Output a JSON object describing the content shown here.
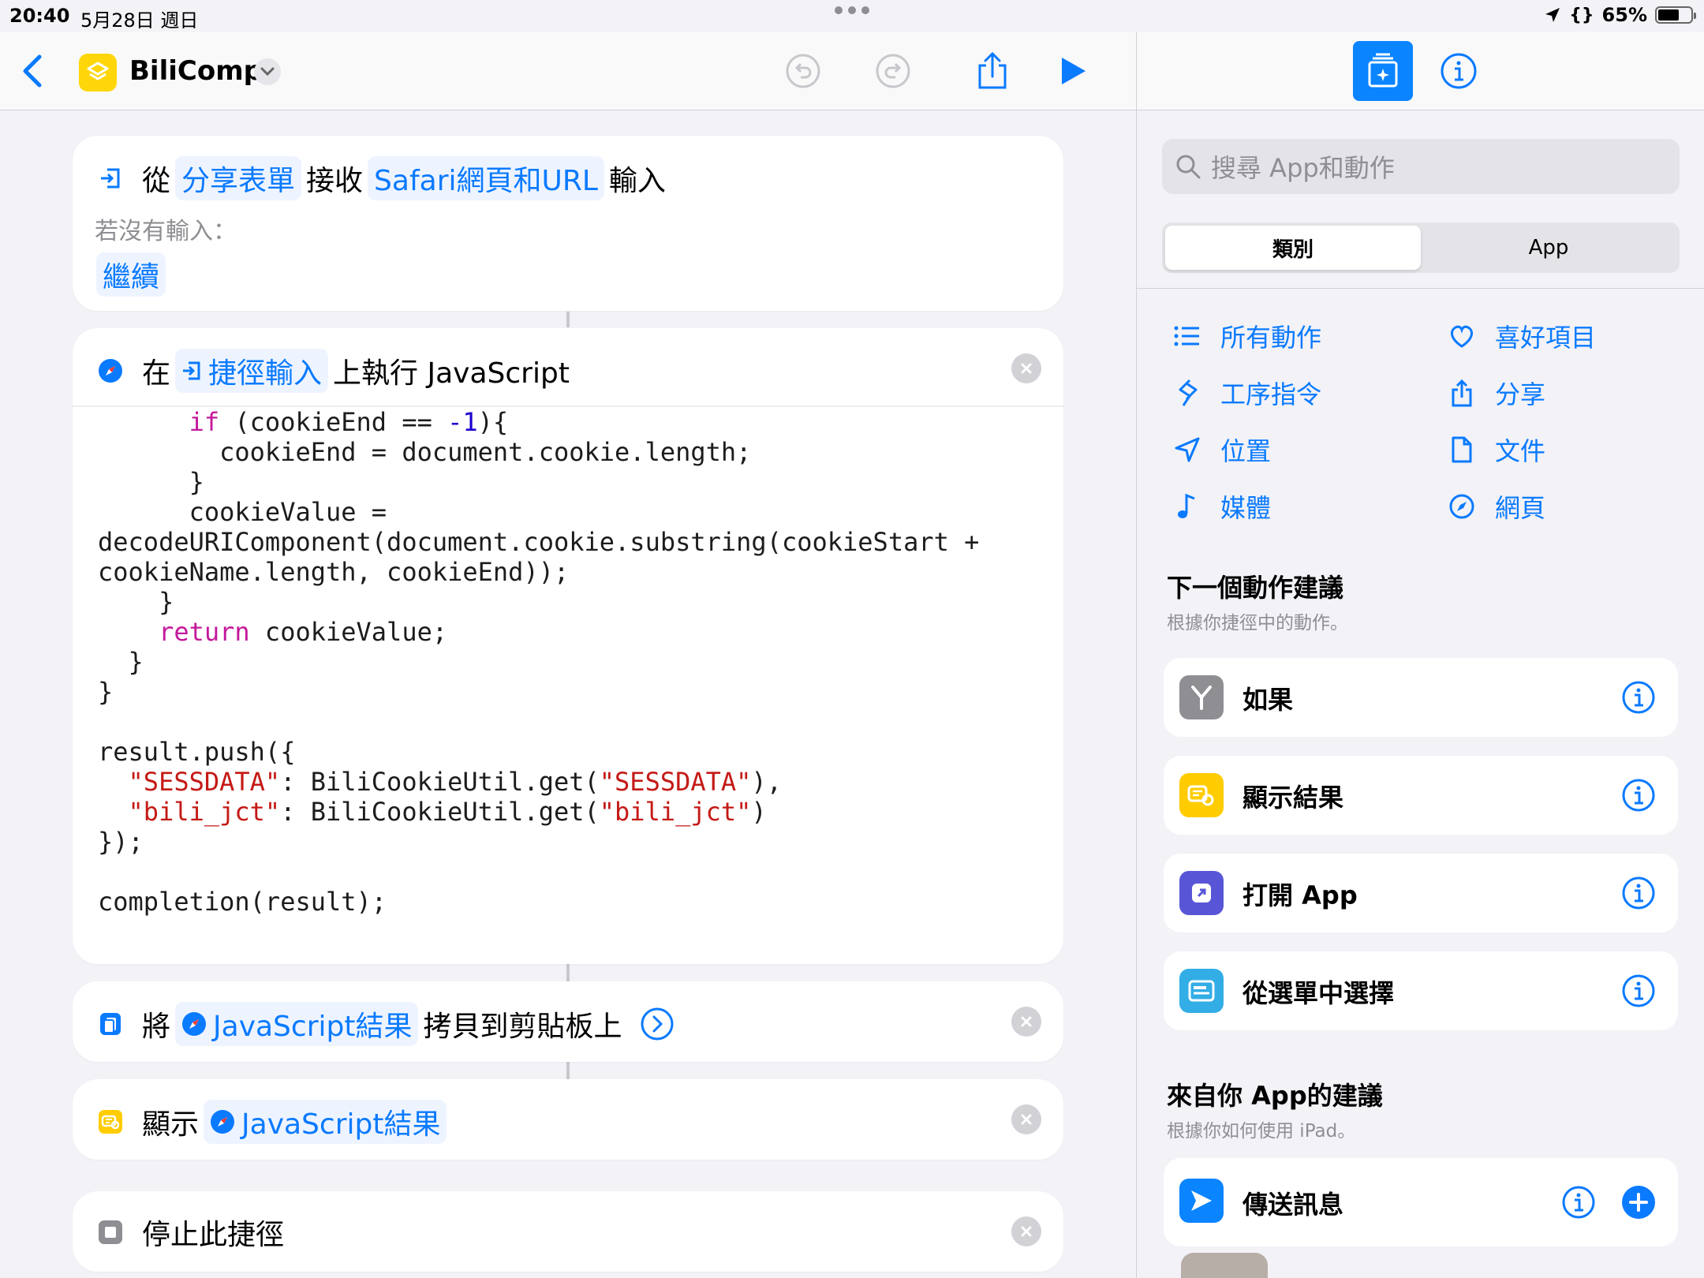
{
  "status_bar": {
    "time": "20:40",
    "date": "5月28日 週日",
    "battery": "65%",
    "battery_level": 0.65
  },
  "editor": {
    "title": "BiliComp"
  },
  "actions": {
    "receive": {
      "from": "從",
      "source": "分享表單",
      "receive": "接收",
      "types": "Safari網頁和URL",
      "input": "輸入",
      "no_input_label": "若沒有輸入：",
      "no_input_value": "繼續"
    },
    "run_js": {
      "at": "在",
      "target": "捷徑輸入",
      "label": "上執行 JavaScript"
    },
    "copy": {
      "prefix": "將",
      "variable": "JavaScript結果",
      "suffix": "拷貝到剪貼板上"
    },
    "show": {
      "prefix": "顯示",
      "variable": "JavaScript結果"
    },
    "stop": {
      "label": "停止此捷徑"
    }
  },
  "code": {
    "l1_kw": "if",
    "l1_a": " (cookieEnd == ",
    "l1_num": "-1",
    "l1_b": "){",
    "l2": "cookieEnd = document.cookie.length;",
    "l3": "}",
    "l4": "cookieValue =",
    "l5": "decodeURIComponent(document.cookie.substring(cookieStart +",
    "l6": "cookieName.length, cookieEnd));",
    "l7": "}",
    "l8_kw": "return",
    "l8": " cookieValue;",
    "l9": "}",
    "l10": "}",
    "l11": "result.push({",
    "l12_s1": "\"SESSDATA\"",
    "l12_m": ": BiliCookieUtil.get(",
    "l12_s2": "\"SESSDATA\"",
    "l12_e": "),",
    "l13_s1": "\"bili_jct\"",
    "l13_m": ": BiliCookieUtil.get(",
    "l13_s2": "\"bili_jct\"",
    "l13_e": ")",
    "l14": "});",
    "l15": "completion(result);"
  },
  "panel": {
    "search_placeholder": "搜尋 App和動作",
    "segments": [
      "類別",
      "App"
    ],
    "categories": {
      "all": "所有動作",
      "favorites": "喜好項目",
      "scripting": "工序指令",
      "share": "分享",
      "location": "位置",
      "documents": "文件",
      "media": "媒體",
      "web": "網頁"
    },
    "next_title": "下一個動作建議",
    "next_sub": "根據你捷徑中的動作。",
    "suggestions": [
      "如果",
      "顯示結果",
      "打開 App",
      "從選單中選擇"
    ],
    "apps_title": "來自你 App的建議",
    "apps_sub": "根據你如何使用 iPad。",
    "app_suggestion": "傳送訊息"
  },
  "colors": {
    "accent": "#0a7aff",
    "shortcut_yellow": "#ffd60a",
    "background": "#f2f2f7"
  }
}
